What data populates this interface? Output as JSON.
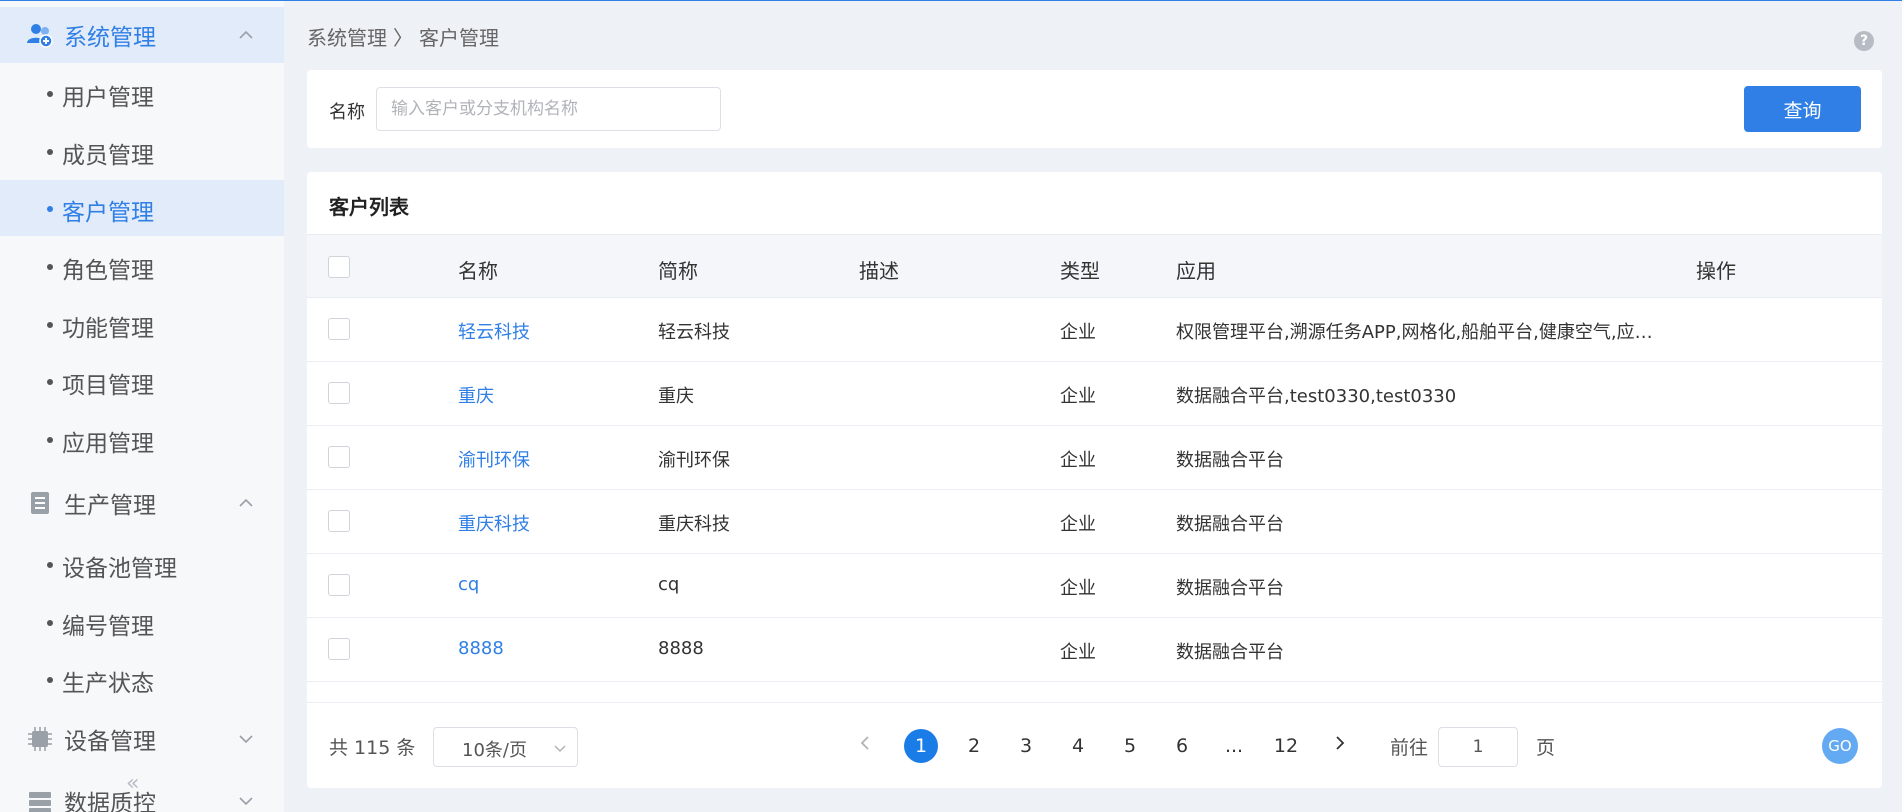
{
  "sidebar": {
    "system_group": "系统管理",
    "system_items": [
      "用户管理",
      "成员管理",
      "客户管理",
      "角色管理",
      "功能管理",
      "项目管理",
      "应用管理"
    ],
    "production_group": "生产管理",
    "production_items": [
      "设备池管理",
      "编号管理",
      "生产状态"
    ],
    "device_group": "设备管理",
    "data_group": "数据质控",
    "collapse_glyph": "«"
  },
  "breadcrumb": {
    "parent": "系统管理",
    "separator": "〉",
    "current": "客户管理"
  },
  "help_glyph": "?",
  "search": {
    "label": "名称",
    "placeholder": "输入客户或分支机构名称",
    "value": "",
    "button": "查询"
  },
  "table": {
    "title": "客户列表",
    "columns": [
      "名称",
      "简称",
      "描述",
      "类型",
      "应用",
      "操作"
    ],
    "rows": [
      {
        "name": "轻云科技",
        "short": "轻云科技",
        "desc": "",
        "type": "企业",
        "apps": "权限管理平台,溯源任务APP,网格化,船舶平台,健康空气,应急指..."
      },
      {
        "name": "重庆",
        "short": "重庆",
        "desc": "",
        "type": "企业",
        "apps": "数据融合平台,test0330,test0330"
      },
      {
        "name": "渝刊环保",
        "short": "渝刊环保",
        "desc": "",
        "type": "企业",
        "apps": "数据融合平台"
      },
      {
        "name": "重庆科技",
        "short": "重庆科技",
        "desc": "",
        "type": "企业",
        "apps": "数据融合平台"
      },
      {
        "name": "cq",
        "short": "cq",
        "desc": "",
        "type": "企业",
        "apps": "数据融合平台"
      },
      {
        "name": "8888",
        "short": "8888",
        "desc": "",
        "type": "企业",
        "apps": "数据融合平台"
      }
    ]
  },
  "pagination": {
    "total": "共 115 条",
    "page_size": "10条/页",
    "pages": [
      "1",
      "2",
      "3",
      "4",
      "5",
      "6",
      "...",
      "12"
    ],
    "current": "1",
    "goto_label": "前往",
    "goto_value": "1",
    "page_label": "页",
    "go_button": "GO"
  },
  "colors": {
    "accent": "#2f7fe6",
    "active_bg": "#e2ebf9",
    "page_bg": "#eef1f6"
  }
}
